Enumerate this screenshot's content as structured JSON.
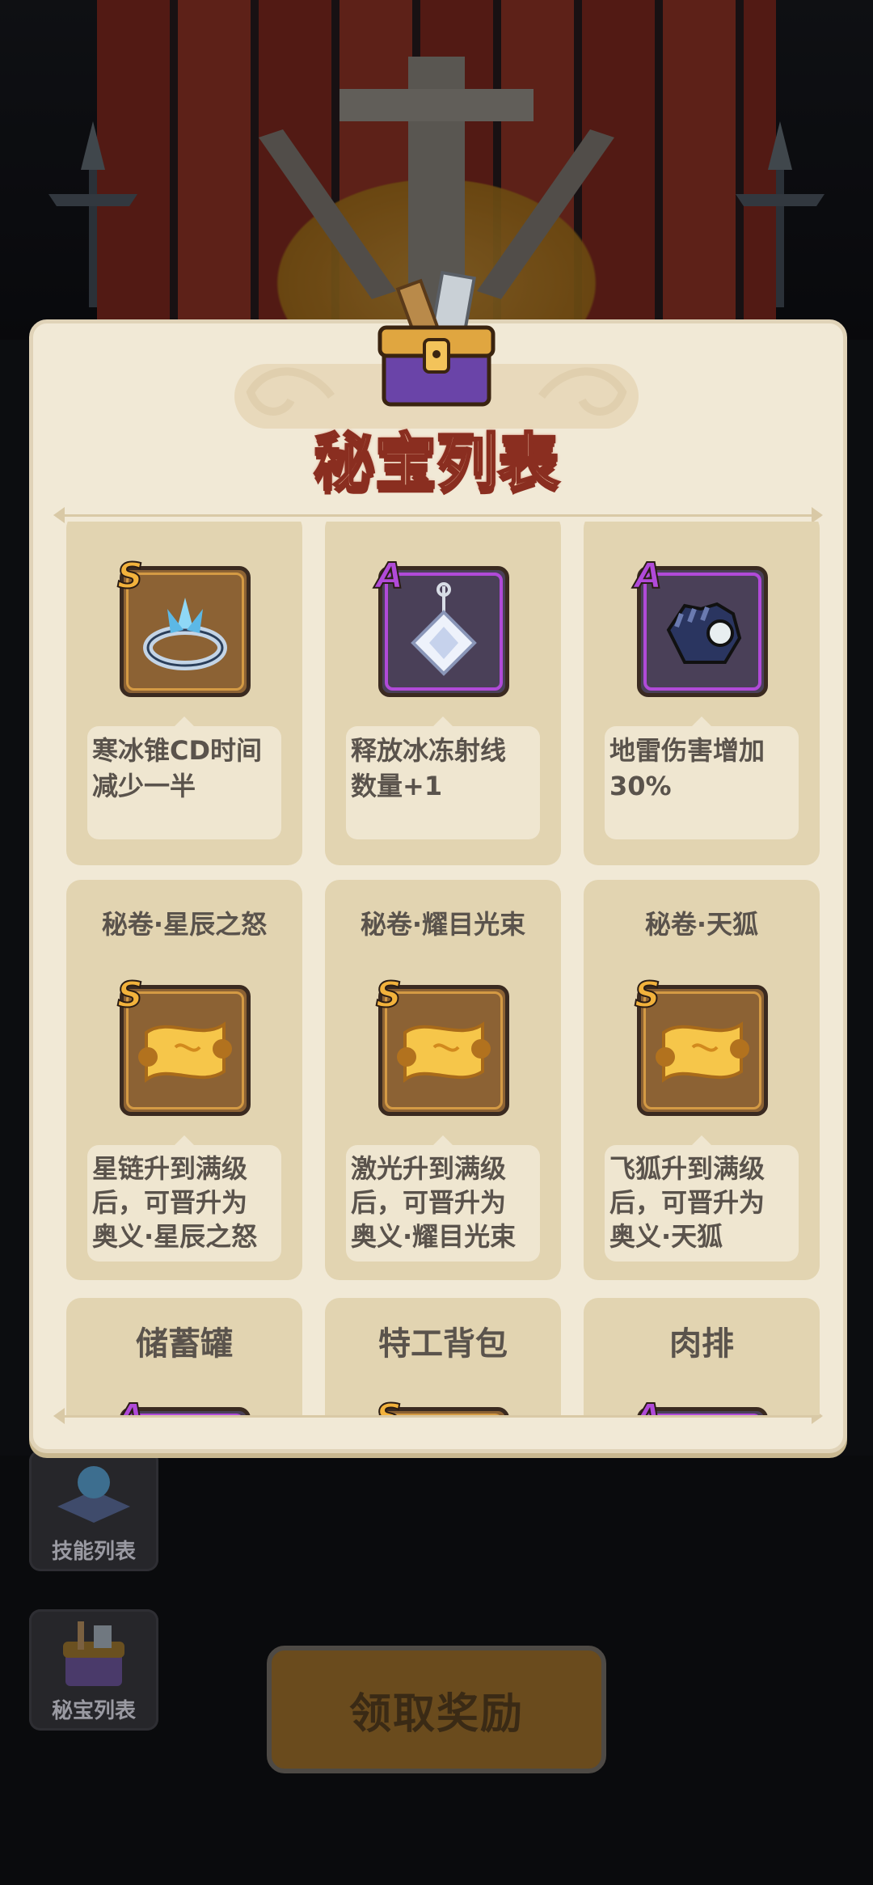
{
  "panel": {
    "title": "秘宝列表"
  },
  "rows": [
    [
      {
        "name": "",
        "rank": "S",
        "rank_type": "s",
        "icon": "frost-ring-icon",
        "desc": "寒冰锥CD时间\n减少一半"
      },
      {
        "name": "",
        "rank": "A",
        "rank_type": "a",
        "icon": "ice-pendant-icon",
        "desc": "释放冰冻射线\n数量+1"
      },
      {
        "name": "",
        "rank": "A",
        "rank_type": "a",
        "icon": "orb-glove-icon",
        "desc": "地雷伤害增加\n30%"
      }
    ],
    [
      {
        "name": "秘卷·星辰之怒",
        "rank": "S",
        "rank_type": "s",
        "icon": "golden-scroll-icon",
        "desc": "星链升到满级\n后，可晋升为\n奥义·星辰之怒"
      },
      {
        "name": "秘卷·耀目光束",
        "rank": "S",
        "rank_type": "s",
        "icon": "golden-scroll-icon",
        "desc": "激光升到满级\n后，可晋升为\n奥义·耀目光束"
      },
      {
        "name": "秘卷·天狐",
        "rank": "S",
        "rank_type": "s",
        "icon": "golden-scroll-icon",
        "desc": "飞狐升到满级\n后，可晋升为\n奥义·天狐"
      }
    ],
    [
      {
        "name": "储蓄罐",
        "rank": "A",
        "rank_type": "a"
      },
      {
        "name": "特工背包",
        "rank": "S",
        "rank_type": "s"
      },
      {
        "name": "肉排",
        "rank": "A",
        "rank_type": "a"
      }
    ]
  ],
  "side_buttons": {
    "skills": "技能列表",
    "treasures": "秘宝列表"
  },
  "claim_button": "领取奖励",
  "colors": {
    "s_rank": "#f2b23c",
    "a_rank": "#b04ad8",
    "title": "#ffe4c4"
  }
}
